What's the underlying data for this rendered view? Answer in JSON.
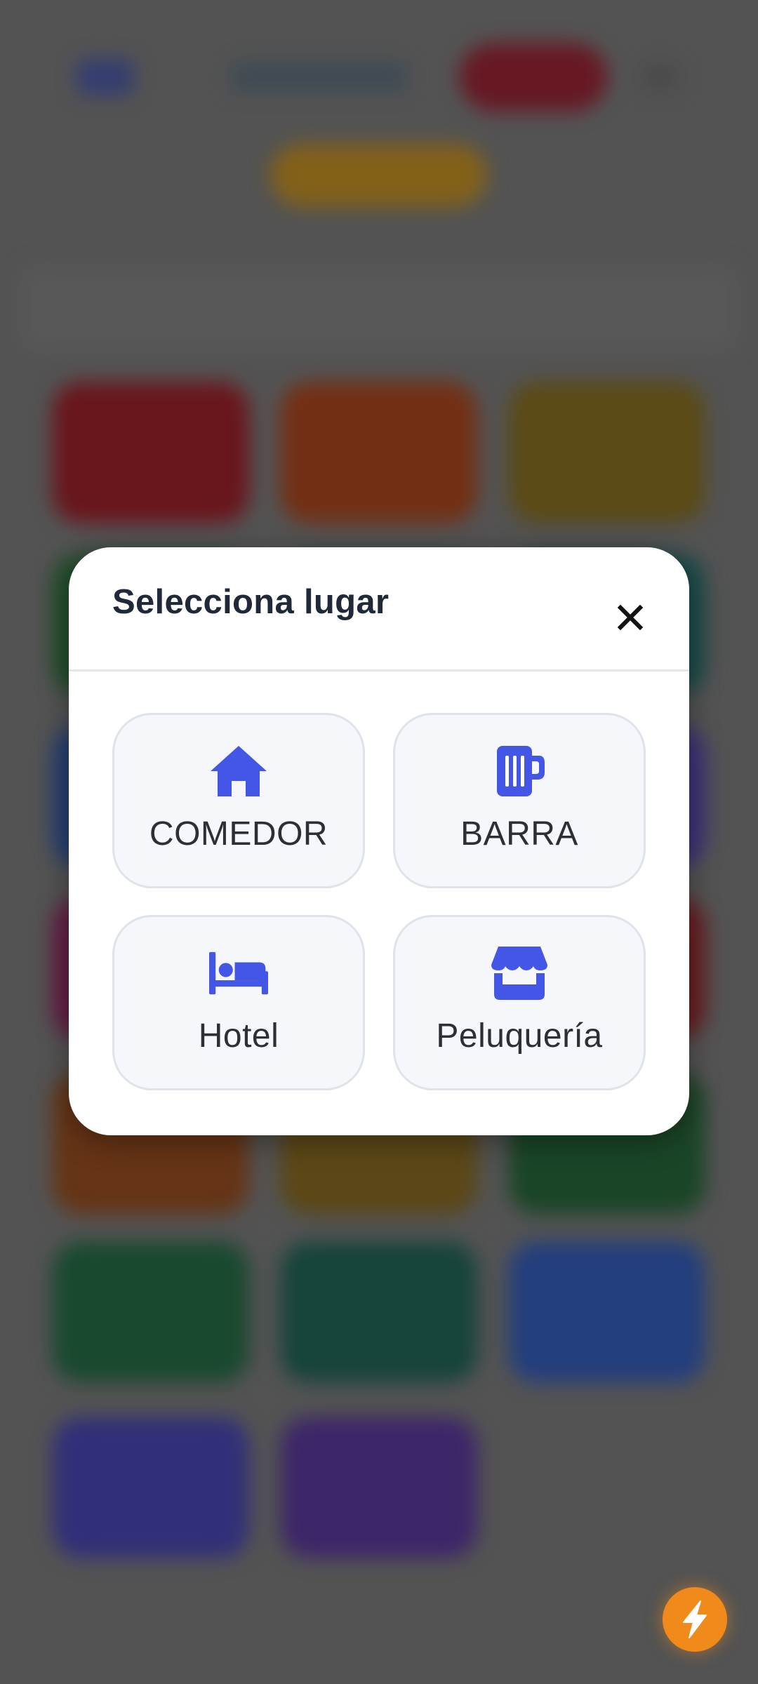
{
  "modal": {
    "title": "Selecciona lugar",
    "options": [
      {
        "label": "COMEDOR",
        "icon": "house-icon"
      },
      {
        "label": "BARRA",
        "icon": "beer-mug-icon"
      },
      {
        "label": "Hotel",
        "icon": "bed-icon"
      },
      {
        "label": "Peluquería",
        "icon": "store-icon"
      }
    ]
  },
  "fab": {
    "icon": "lightning-bolt-icon"
  },
  "colors": {
    "accent": "#4356e6",
    "fab": "#f08a1a",
    "backdrop": "#545454"
  }
}
